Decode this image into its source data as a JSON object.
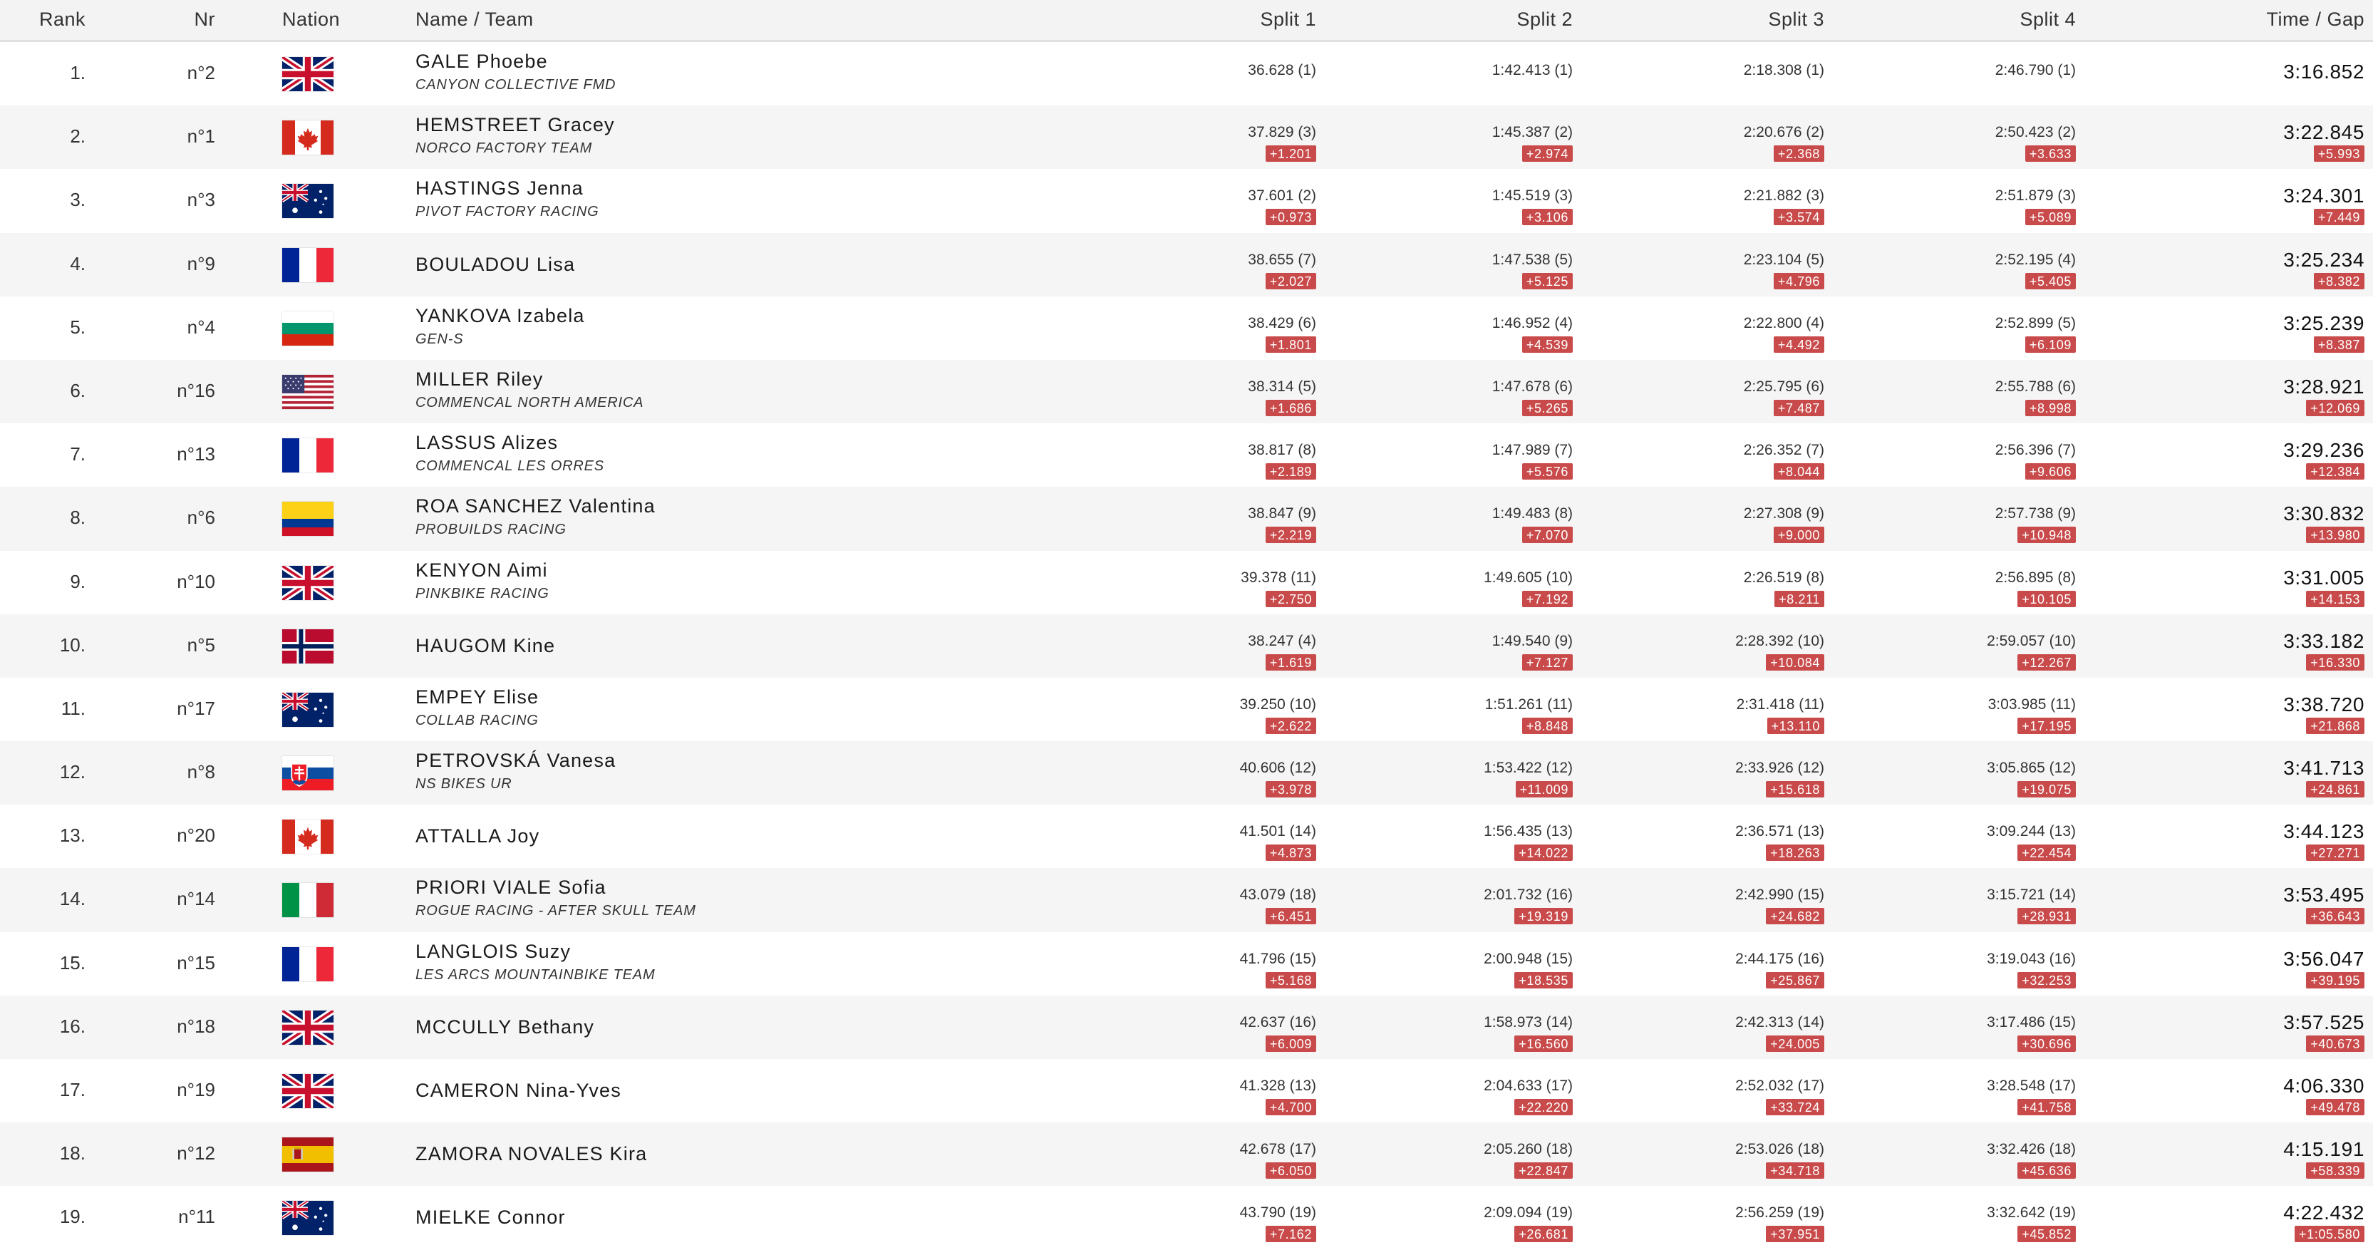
{
  "header": {
    "rank": "Rank",
    "nr": "Nr",
    "nation": "Nation",
    "name": "Name / Team",
    "split1": "Split 1",
    "split2": "Split 2",
    "split3": "Split 3",
    "split4": "Split 4",
    "time": "Time / Gap"
  },
  "rows": [
    {
      "rank": "1.",
      "nr": "n°2",
      "flag": "gb",
      "name": "GALE Phoebe",
      "team": "CANYON COLLECTIVE FMD",
      "s1": "36.628 (1)",
      "g1": "",
      "s2": "1:42.413 (1)",
      "g2": "",
      "s3": "2:18.308 (1)",
      "g3": "",
      "s4": "2:46.790 (1)",
      "g4": "",
      "time": "3:16.852",
      "gap": ""
    },
    {
      "rank": "2.",
      "nr": "n°1",
      "flag": "ca",
      "name": "HEMSTREET Gracey",
      "team": "NORCO FACTORY TEAM",
      "s1": "37.829 (3)",
      "g1": "+1.201",
      "s2": "1:45.387 (2)",
      "g2": "+2.974",
      "s3": "2:20.676 (2)",
      "g3": "+2.368",
      "s4": "2:50.423 (2)",
      "g4": "+3.633",
      "time": "3:22.845",
      "gap": "+5.993"
    },
    {
      "rank": "3.",
      "nr": "n°3",
      "flag": "au",
      "name": "HASTINGS Jenna",
      "team": "PIVOT FACTORY RACING",
      "s1": "37.601 (2)",
      "g1": "+0.973",
      "s2": "1:45.519 (3)",
      "g2": "+3.106",
      "s3": "2:21.882 (3)",
      "g3": "+3.574",
      "s4": "2:51.879 (3)",
      "g4": "+5.089",
      "time": "3:24.301",
      "gap": "+7.449"
    },
    {
      "rank": "4.",
      "nr": "n°9",
      "flag": "fr",
      "name": "BOULADOU Lisa",
      "team": "",
      "s1": "38.655 (7)",
      "g1": "+2.027",
      "s2": "1:47.538 (5)",
      "g2": "+5.125",
      "s3": "2:23.104 (5)",
      "g3": "+4.796",
      "s4": "2:52.195 (4)",
      "g4": "+5.405",
      "time": "3:25.234",
      "gap": "+8.382"
    },
    {
      "rank": "5.",
      "nr": "n°4",
      "flag": "bg",
      "name": "YANKOVA Izabela",
      "team": "GEN-S",
      "s1": "38.429 (6)",
      "g1": "+1.801",
      "s2": "1:46.952 (4)",
      "g2": "+4.539",
      "s3": "2:22.800 (4)",
      "g3": "+4.492",
      "s4": "2:52.899 (5)",
      "g4": "+6.109",
      "time": "3:25.239",
      "gap": "+8.387"
    },
    {
      "rank": "6.",
      "nr": "n°16",
      "flag": "us",
      "name": "MILLER Riley",
      "team": "COMMENCAL NORTH AMERICA",
      "s1": "38.314 (5)",
      "g1": "+1.686",
      "s2": "1:47.678 (6)",
      "g2": "+5.265",
      "s3": "2:25.795 (6)",
      "g3": "+7.487",
      "s4": "2:55.788 (6)",
      "g4": "+8.998",
      "time": "3:28.921",
      "gap": "+12.069"
    },
    {
      "rank": "7.",
      "nr": "n°13",
      "flag": "fr",
      "name": "LASSUS Alizes",
      "team": "COMMENCAL LES ORRES",
      "s1": "38.817 (8)",
      "g1": "+2.189",
      "s2": "1:47.989 (7)",
      "g2": "+5.576",
      "s3": "2:26.352 (7)",
      "g3": "+8.044",
      "s4": "2:56.396 (7)",
      "g4": "+9.606",
      "time": "3:29.236",
      "gap": "+12.384"
    },
    {
      "rank": "8.",
      "nr": "n°6",
      "flag": "co",
      "name": "ROA SANCHEZ Valentina",
      "team": "PROBUILDS RACING",
      "s1": "38.847 (9)",
      "g1": "+2.219",
      "s2": "1:49.483 (8)",
      "g2": "+7.070",
      "s3": "2:27.308 (9)",
      "g3": "+9.000",
      "s4": "2:57.738 (9)",
      "g4": "+10.948",
      "time": "3:30.832",
      "gap": "+13.980"
    },
    {
      "rank": "9.",
      "nr": "n°10",
      "flag": "gb",
      "name": "KENYON Aimi",
      "team": "PINKBIKE RACING",
      "s1": "39.378 (11)",
      "g1": "+2.750",
      "s2": "1:49.605 (10)",
      "g2": "+7.192",
      "s3": "2:26.519 (8)",
      "g3": "+8.211",
      "s4": "2:56.895 (8)",
      "g4": "+10.105",
      "time": "3:31.005",
      "gap": "+14.153"
    },
    {
      "rank": "10.",
      "nr": "n°5",
      "flag": "no",
      "name": "HAUGOM Kine",
      "team": "",
      "s1": "38.247 (4)",
      "g1": "+1.619",
      "s2": "1:49.540 (9)",
      "g2": "+7.127",
      "s3": "2:28.392 (10)",
      "g3": "+10.084",
      "s4": "2:59.057 (10)",
      "g4": "+12.267",
      "time": "3:33.182",
      "gap": "+16.330"
    },
    {
      "rank": "11.",
      "nr": "n°17",
      "flag": "au",
      "name": "EMPEY Elise",
      "team": "COLLAB RACING",
      "s1": "39.250 (10)",
      "g1": "+2.622",
      "s2": "1:51.261 (11)",
      "g2": "+8.848",
      "s3": "2:31.418 (11)",
      "g3": "+13.110",
      "s4": "3:03.985 (11)",
      "g4": "+17.195",
      "time": "3:38.720",
      "gap": "+21.868"
    },
    {
      "rank": "12.",
      "nr": "n°8",
      "flag": "sk",
      "name": "PETROVSKÁ Vanesa",
      "team": "NS BIKES UR",
      "s1": "40.606 (12)",
      "g1": "+3.978",
      "s2": "1:53.422 (12)",
      "g2": "+11.009",
      "s3": "2:33.926 (12)",
      "g3": "+15.618",
      "s4": "3:05.865 (12)",
      "g4": "+19.075",
      "time": "3:41.713",
      "gap": "+24.861"
    },
    {
      "rank": "13.",
      "nr": "n°20",
      "flag": "ca",
      "name": "ATTALLA Joy",
      "team": "",
      "s1": "41.501 (14)",
      "g1": "+4.873",
      "s2": "1:56.435 (13)",
      "g2": "+14.022",
      "s3": "2:36.571 (13)",
      "g3": "+18.263",
      "s4": "3:09.244 (13)",
      "g4": "+22.454",
      "time": "3:44.123",
      "gap": "+27.271"
    },
    {
      "rank": "14.",
      "nr": "n°14",
      "flag": "it",
      "name": "PRIORI VIALE Sofia",
      "team": "ROGUE RACING - AFTER SKULL TEAM",
      "s1": "43.079 (18)",
      "g1": "+6.451",
      "s2": "2:01.732 (16)",
      "g2": "+19.319",
      "s3": "2:42.990 (15)",
      "g3": "+24.682",
      "s4": "3:15.721 (14)",
      "g4": "+28.931",
      "time": "3:53.495",
      "gap": "+36.643"
    },
    {
      "rank": "15.",
      "nr": "n°15",
      "flag": "fr",
      "name": "LANGLOIS Suzy",
      "team": "LES ARCS MOUNTAINBIKE TEAM",
      "s1": "41.796 (15)",
      "g1": "+5.168",
      "s2": "2:00.948 (15)",
      "g2": "+18.535",
      "s3": "2:44.175 (16)",
      "g3": "+25.867",
      "s4": "3:19.043 (16)",
      "g4": "+32.253",
      "time": "3:56.047",
      "gap": "+39.195"
    },
    {
      "rank": "16.",
      "nr": "n°18",
      "flag": "gb",
      "name": "MCCULLY Bethany",
      "team": "",
      "s1": "42.637 (16)",
      "g1": "+6.009",
      "s2": "1:58.973 (14)",
      "g2": "+16.560",
      "s3": "2:42.313 (14)",
      "g3": "+24.005",
      "s4": "3:17.486 (15)",
      "g4": "+30.696",
      "time": "3:57.525",
      "gap": "+40.673"
    },
    {
      "rank": "17.",
      "nr": "n°19",
      "flag": "gb",
      "name": "CAMERON Nina-Yves",
      "team": "",
      "s1": "41.328 (13)",
      "g1": "+4.700",
      "s2": "2:04.633 (17)",
      "g2": "+22.220",
      "s3": "2:52.032 (17)",
      "g3": "+33.724",
      "s4": "3:28.548 (17)",
      "g4": "+41.758",
      "time": "4:06.330",
      "gap": "+49.478"
    },
    {
      "rank": "18.",
      "nr": "n°12",
      "flag": "es",
      "name": "ZAMORA NOVALES Kira",
      "team": "",
      "s1": "42.678 (17)",
      "g1": "+6.050",
      "s2": "2:05.260 (18)",
      "g2": "+22.847",
      "s3": "2:53.026 (18)",
      "g3": "+34.718",
      "s4": "3:32.426 (18)",
      "g4": "+45.636",
      "time": "4:15.191",
      "gap": "+58.339"
    },
    {
      "rank": "19.",
      "nr": "n°11",
      "flag": "au",
      "name": "MIELKE Connor",
      "team": "",
      "s1": "43.790 (19)",
      "g1": "+7.162",
      "s2": "2:09.094 (19)",
      "g2": "+26.681",
      "s3": "2:56.259 (19)",
      "g3": "+37.951",
      "s4": "3:32.642 (19)",
      "g4": "+45.852",
      "time": "4:22.432",
      "gap": "+1:05.580"
    }
  ]
}
